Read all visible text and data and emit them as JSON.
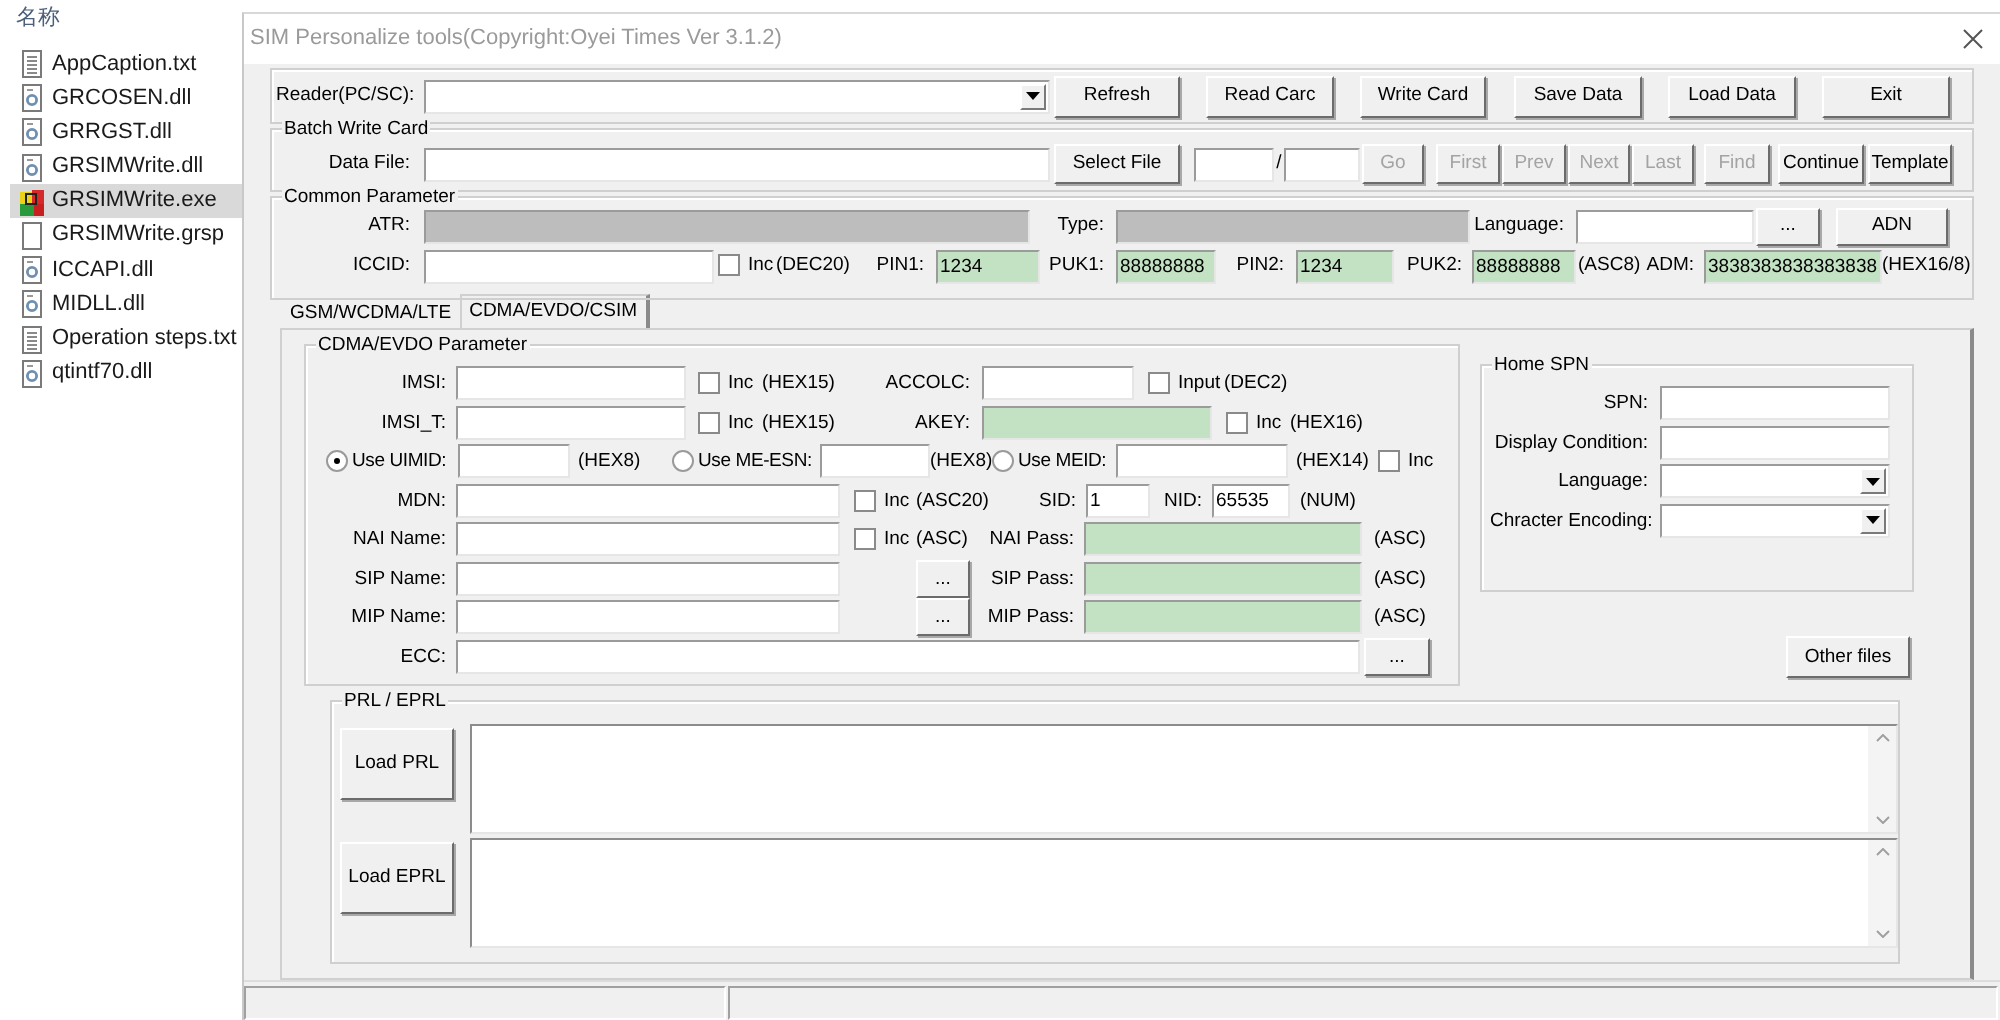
{
  "explorer": {
    "column_header": "名称",
    "files": [
      {
        "name": "AppCaption.txt",
        "kind": "text",
        "selected": false
      },
      {
        "name": "GRCOSEN.dll",
        "kind": "library",
        "selected": false
      },
      {
        "name": "GRRGST.dll",
        "kind": "library",
        "selected": false
      },
      {
        "name": "GRSIMWrite.dll",
        "kind": "library",
        "selected": false
      },
      {
        "name": "GRSIMWrite.exe",
        "kind": "program",
        "selected": true
      },
      {
        "name": "GRSIMWrite.grsp",
        "kind": "blank",
        "selected": false
      },
      {
        "name": "ICCAPI.dll",
        "kind": "library",
        "selected": false
      },
      {
        "name": "MIDLL.dll",
        "kind": "library",
        "selected": false
      },
      {
        "name": "Operation steps.txt",
        "kind": "text",
        "selected": false
      },
      {
        "name": "qtintf70.dll",
        "kind": "library",
        "selected": false
      }
    ]
  },
  "window": {
    "title": "SIM Personalize tools(Copyright:Oyei Times Ver 3.1.2)"
  },
  "reader": {
    "rows": [
      {
        "items": [
          {
            "kind": "label",
            "text": "Reader(PC/SC):"
          },
          {
            "kind": "select"
          },
          {
            "kind": "button",
            "label": "Refresh",
            "disabled": false
          },
          {
            "kind": "button",
            "label": "Read Carc",
            "disabled": false
          },
          {
            "kind": "button",
            "label": "Write Card",
            "disabled": false
          },
          {
            "kind": "button",
            "label": "Save Data",
            "disabled": false
          },
          {
            "kind": "button",
            "label": "Load Data",
            "disabled": false
          },
          {
            "kind": "button",
            "label": "Exit",
            "disabled": false
          }
        ]
      }
    ]
  },
  "batch": {
    "legend": "Batch Write Card",
    "rows": [
      {
        "items": [
          {
            "kind": "label",
            "text": "Data File:"
          },
          {
            "kind": "field"
          },
          {
            "kind": "button",
            "label": "Select File",
            "disabled": false
          },
          {
            "kind": "field"
          },
          {
            "kind": "separator",
            "text": "/"
          },
          {
            "kind": "field"
          },
          {
            "kind": "button",
            "label": "Go",
            "disabled": true
          },
          {
            "kind": "button",
            "label": "First",
            "disabled": true
          },
          {
            "kind": "button",
            "label": "Prev",
            "disabled": true
          },
          {
            "kind": "button",
            "label": "Next",
            "disabled": true
          },
          {
            "kind": "button",
            "label": "Last",
            "disabled": true
          },
          {
            "kind": "button",
            "label": "Find",
            "disabled": true
          },
          {
            "kind": "button",
            "label": "Continue",
            "disabled": false
          },
          {
            "kind": "button",
            "label": "Template",
            "disabled": false
          }
        ]
      }
    ]
  },
  "common": {
    "legend": "Common Parameter",
    "rows": [
      {
        "items": [
          {
            "kind": "label",
            "text": "ATR:"
          },
          {
            "kind": "readonly_field"
          },
          {
            "kind": "label",
            "text": "Type:"
          },
          {
            "kind": "readonly_field"
          },
          {
            "kind": "label",
            "text": "Language:"
          },
          {
            "kind": "field"
          },
          {
            "kind": "button",
            "label": "...",
            "disabled": false
          },
          {
            "kind": "button",
            "label": "ADN",
            "disabled": false
          }
        ]
      },
      {
        "items": [
          {
            "kind": "label",
            "text": "ICCID:"
          },
          {
            "kind": "field"
          },
          {
            "kind": "check",
            "label": "Inc",
            "checked": false
          },
          {
            "kind": "note",
            "text": "(DEC20)"
          },
          {
            "kind": "label",
            "text": "PIN1:"
          },
          {
            "kind": "secure_field",
            "value": "1234"
          },
          {
            "kind": "label",
            "text": "PUK1:"
          },
          {
            "kind": "secure_field",
            "value": "88888888"
          },
          {
            "kind": "label",
            "text": "PIN2:"
          },
          {
            "kind": "secure_field",
            "value": "1234"
          },
          {
            "kind": "label",
            "text": "PUK2:"
          },
          {
            "kind": "secure_field",
            "value": "88888888"
          },
          {
            "kind": "note",
            "text": "(ASC8)"
          },
          {
            "kind": "label",
            "text": "ADM:"
          },
          {
            "kind": "secure_field",
            "value": "3838383838383838"
          },
          {
            "kind": "note",
            "text": "(HEX16/8)"
          }
        ]
      }
    ]
  },
  "tabs": [
    {
      "label": "GSM/WCDMA/LTE",
      "selected": false
    },
    {
      "label": "CDMA/EVDO/CSIM",
      "selected": true
    }
  ],
  "cdma": {
    "legend": "CDMA/EVDO Parameter",
    "rows": [
      {
        "items": [
          {
            "kind": "label",
            "text": "IMSI:"
          },
          {
            "kind": "field"
          },
          {
            "kind": "check",
            "label": "Inc",
            "checked": false
          },
          {
            "kind": "note",
            "text": "(HEX15)"
          },
          {
            "kind": "label",
            "text": "ACCOLC:"
          },
          {
            "kind": "field"
          },
          {
            "kind": "check",
            "label": "Input",
            "checked": false
          },
          {
            "kind": "note",
            "text": "(DEC2)"
          }
        ]
      },
      {
        "items": [
          {
            "kind": "label",
            "text": "IMSI_T:"
          },
          {
            "kind": "field"
          },
          {
            "kind": "check",
            "label": "Inc",
            "checked": false
          },
          {
            "kind": "note",
            "text": "(HEX15)"
          },
          {
            "kind": "label",
            "text": "AKEY:"
          },
          {
            "kind": "secure_field"
          },
          {
            "kind": "check",
            "label": "Inc",
            "checked": false
          },
          {
            "kind": "note",
            "text": "(HEX16)"
          }
        ]
      },
      {
        "items": [
          {
            "kind": "radio",
            "label": "Use UIMID:",
            "selected": true
          },
          {
            "kind": "field"
          },
          {
            "kind": "note",
            "text": "(HEX8)"
          },
          {
            "kind": "radio",
            "label": "Use ME-ESN:",
            "selected": false
          },
          {
            "kind": "field"
          },
          {
            "kind": "note",
            "text": "(HEX8)"
          },
          {
            "kind": "radio",
            "label": "Use MEID:",
            "selected": false
          },
          {
            "kind": "field"
          },
          {
            "kind": "note",
            "text": "(HEX14)"
          },
          {
            "kind": "check",
            "label": "Inc",
            "checked": false
          }
        ]
      },
      {
        "items": [
          {
            "kind": "label",
            "text": "MDN:"
          },
          {
            "kind": "field"
          },
          {
            "kind": "check",
            "label": "Inc",
            "checked": false
          },
          {
            "kind": "note",
            "text": "(ASC20)"
          },
          {
            "kind": "label",
            "text": "SID:"
          },
          {
            "kind": "field",
            "value": "1"
          },
          {
            "kind": "label",
            "text": "NID:"
          },
          {
            "kind": "field",
            "value": "65535"
          },
          {
            "kind": "note",
            "text": "(NUM)"
          }
        ]
      },
      {
        "items": [
          {
            "kind": "label",
            "text": "NAI Name:"
          },
          {
            "kind": "field"
          },
          {
            "kind": "check",
            "label": "Inc",
            "checked": false
          },
          {
            "kind": "note",
            "text": "(ASC)"
          },
          {
            "kind": "label",
            "text": "NAI Pass:"
          },
          {
            "kind": "secure_field"
          },
          {
            "kind": "note",
            "text": "(ASC)"
          }
        ]
      },
      {
        "items": [
          {
            "kind": "label",
            "text": "SIP Name:"
          },
          {
            "kind": "field"
          },
          {
            "kind": "button",
            "label": "...",
            "disabled": false
          },
          {
            "kind": "label",
            "text": "SIP Pass:"
          },
          {
            "kind": "secure_field"
          },
          {
            "kind": "note",
            "text": "(ASC)"
          }
        ]
      },
      {
        "items": [
          {
            "kind": "label",
            "text": "MIP Name:"
          },
          {
            "kind": "field"
          },
          {
            "kind": "button",
            "label": "...",
            "disabled": false
          },
          {
            "kind": "label",
            "text": "MIP Pass:"
          },
          {
            "kind": "secure_field"
          },
          {
            "kind": "note",
            "text": "(ASC)"
          }
        ]
      },
      {
        "items": [
          {
            "kind": "label",
            "text": "ECC:"
          },
          {
            "kind": "field"
          },
          {
            "kind": "button",
            "label": "...",
            "disabled": false
          }
        ]
      }
    ]
  },
  "home_spn": {
    "legend": "Home SPN",
    "rows": [
      {
        "items": [
          {
            "kind": "label",
            "text": "SPN:"
          },
          {
            "kind": "field"
          }
        ]
      },
      {
        "items": [
          {
            "kind": "label",
            "text": "Display Condition:"
          },
          {
            "kind": "field"
          }
        ]
      },
      {
        "items": [
          {
            "kind": "label",
            "text": "Language:"
          },
          {
            "kind": "select"
          }
        ]
      },
      {
        "items": [
          {
            "kind": "label",
            "text": "Chracter Encoding:"
          },
          {
            "kind": "select"
          }
        ]
      }
    ]
  },
  "other_files": {
    "label": "Other files"
  },
  "prl": {
    "legend": "PRL / EPRL",
    "buttons": [
      "Load PRL",
      "Load EPRL"
    ]
  }
}
